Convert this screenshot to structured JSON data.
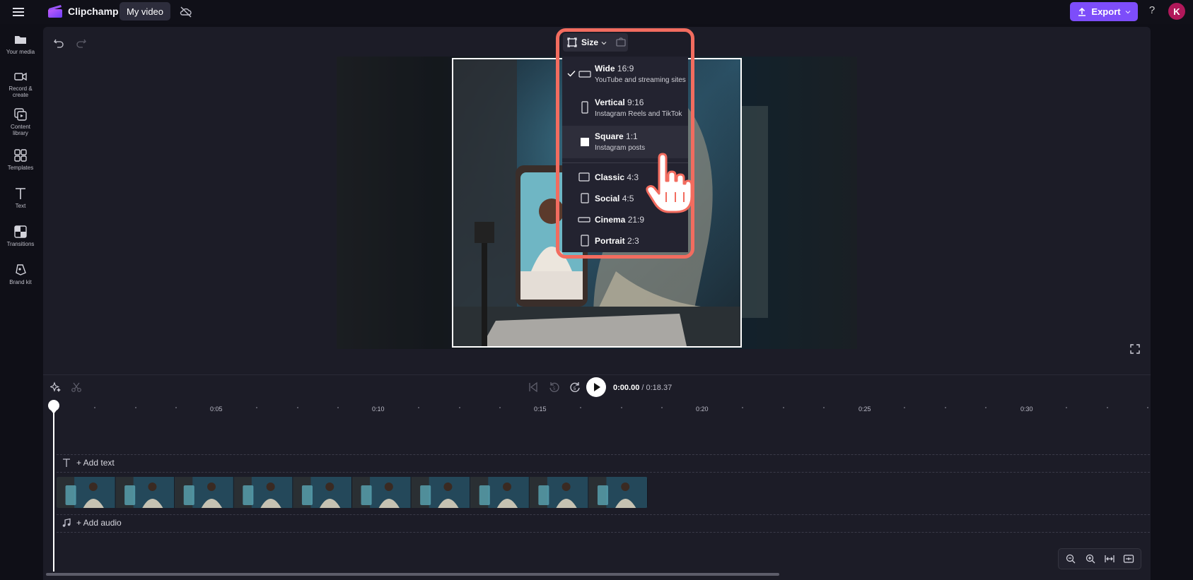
{
  "topbar": {
    "app_name": "Clipchamp",
    "project_title": "My video",
    "export_label": "Export",
    "help": "?",
    "avatar_initial": "K"
  },
  "sidebar": {
    "items": [
      {
        "label": "Your media",
        "icon": "folder-icon"
      },
      {
        "label": "Record & create",
        "icon": "camera-icon"
      },
      {
        "label": "Content library",
        "icon": "library-icon"
      },
      {
        "label": "Templates",
        "icon": "templates-icon"
      },
      {
        "label": "Text",
        "icon": "text-icon"
      },
      {
        "label": "Transitions",
        "icon": "transitions-icon"
      },
      {
        "label": "Brand kit",
        "icon": "brand-kit-icon"
      }
    ]
  },
  "size_menu": {
    "button_label": "Size",
    "options": [
      {
        "name": "Wide",
        "ratio": "16:9",
        "subtitle": "YouTube and streaming sites",
        "selected": true
      },
      {
        "name": "Vertical",
        "ratio": "9:16",
        "subtitle": "Instagram Reels and TikTok",
        "selected": false
      },
      {
        "name": "Square",
        "ratio": "1:1",
        "subtitle": "Instagram posts",
        "selected": false,
        "hovered": true
      },
      {
        "name": "Classic",
        "ratio": "4:3",
        "subtitle": "",
        "selected": false
      },
      {
        "name": "Social",
        "ratio": "4:5",
        "subtitle": "",
        "selected": false
      },
      {
        "name": "Cinema",
        "ratio": "21:9",
        "subtitle": "",
        "selected": false
      },
      {
        "name": "Portrait",
        "ratio": "2:3",
        "subtitle": "",
        "selected": false
      }
    ]
  },
  "playback": {
    "current_time": "0:00.00",
    "separator": " / ",
    "total_time": "0:18.37"
  },
  "timeline": {
    "ruler_labels": [
      "0:05",
      "0:10",
      "0:15",
      "0:20",
      "0:25",
      "0:30"
    ],
    "add_text_label": "+ Add text",
    "add_audio_label": "+ Add audio",
    "clip_thumbnail_count": 10
  },
  "colors": {
    "accent": "#7d4dfa",
    "highlight_outline": "#f26c5f",
    "panel": "#1c1c27",
    "avatar": "#b1185a"
  }
}
